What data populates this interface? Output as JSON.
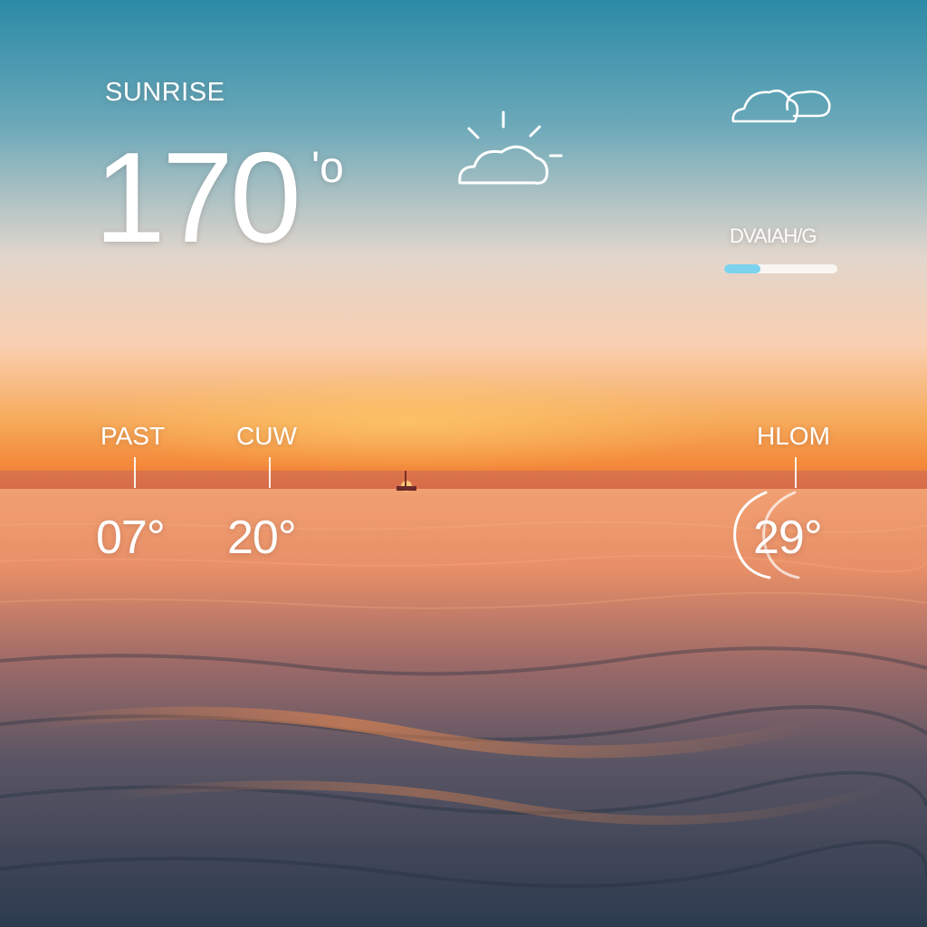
{
  "header": {
    "label": "SUNRISE",
    "temperature": "170",
    "unit": "'o"
  },
  "wind": {
    "label": "DVAIAH/G",
    "progress": 0.32
  },
  "icons": {
    "main": "partly-sunny-icon",
    "top_right": "cloudy-icon",
    "bottom_right": "crescent-moon-icon"
  },
  "columns": [
    {
      "label": "PAST",
      "temp": "07°"
    },
    {
      "label": "CUW",
      "temp": "20°"
    },
    {
      "label": "HLOM",
      "temp": "29°"
    }
  ],
  "colors": {
    "sky_top": "#2f8ea8",
    "sky_mid": "#f6d2bc",
    "horizon": "#f29b44",
    "sea_near": "#303c4e",
    "accent": "#7cd3ee"
  }
}
